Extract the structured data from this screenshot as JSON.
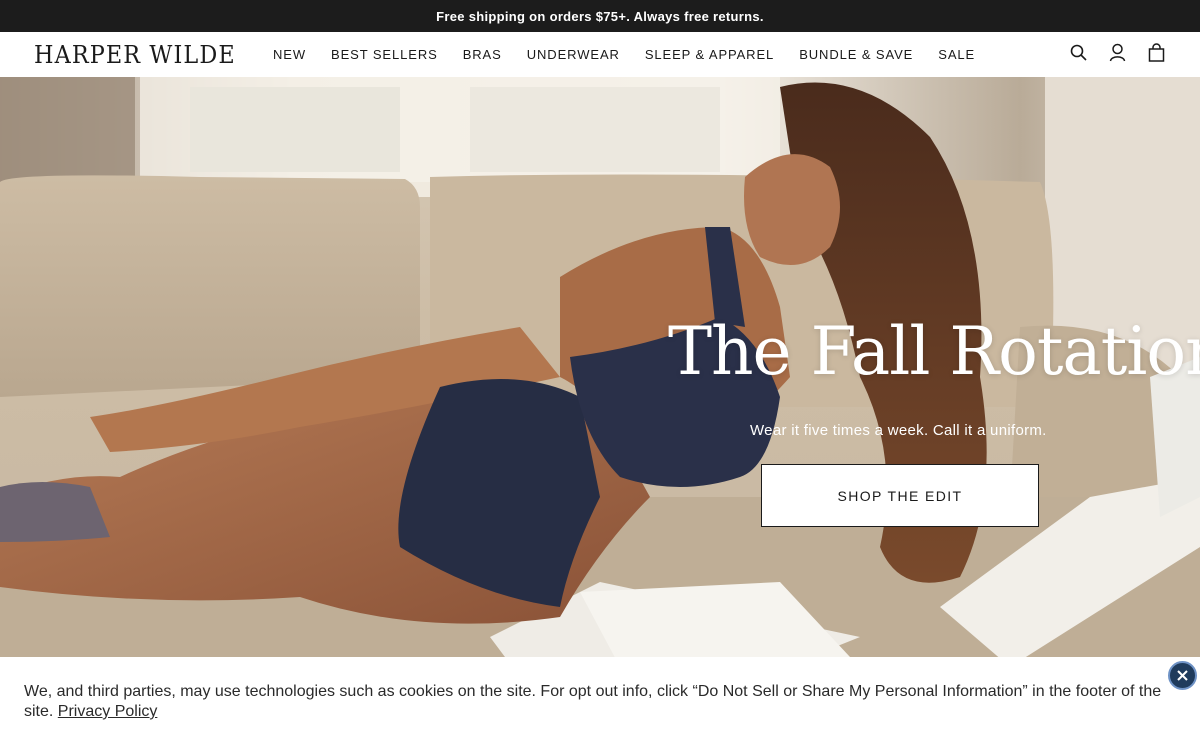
{
  "announcement": {
    "text": "Free shipping on orders $75+. Always free returns."
  },
  "header": {
    "logo": "HARPER WILDE",
    "nav": [
      "NEW",
      "BEST SELLERS",
      "BRAS",
      "UNDERWEAR",
      "SLEEP & APPAREL",
      "BUNDLE & SAVE",
      "SALE"
    ],
    "icons": [
      "search-icon",
      "account-icon",
      "bag-icon"
    ]
  },
  "hero": {
    "title": "The Fall Rotation",
    "subtitle": "Wear it five times a week. Call it a uniform.",
    "cta": "SHOP THE EDIT"
  },
  "cookie": {
    "text": "We, and third parties, may use technologies such as cookies on the site. For opt out info, click “Do Not Sell or Share My Personal Information” in the footer of the site.",
    "link": "Privacy Policy",
    "close_icon": "close-icon"
  },
  "colors": {
    "announcement_bg": "#1c1c1c",
    "accent_close": "#1f3b5c"
  }
}
